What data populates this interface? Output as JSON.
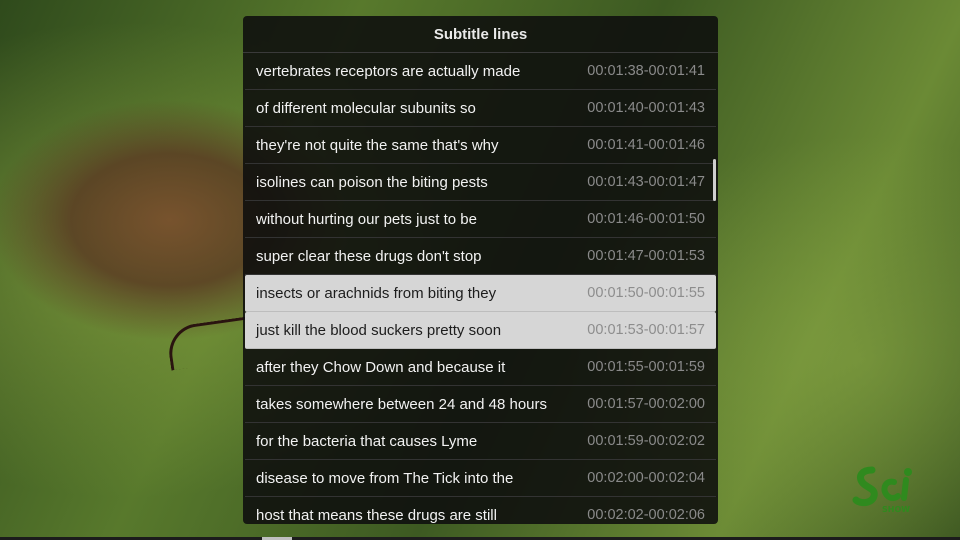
{
  "panel": {
    "title": "Subtitle lines"
  },
  "subtitles": [
    {
      "text": "vertebrates receptors are actually made",
      "time": "00:01:38-00:01:41"
    },
    {
      "text": "of different molecular subunits so",
      "time": "00:01:40-00:01:43"
    },
    {
      "text": "they're not quite the same that's why",
      "time": "00:01:41-00:01:46"
    },
    {
      "text": "isolines can poison the biting pests",
      "time": "00:01:43-00:01:47"
    },
    {
      "text": "without hurting our pets just to be",
      "time": "00:01:46-00:01:50"
    },
    {
      "text": "super clear these drugs don't stop",
      "time": "00:01:47-00:01:53"
    },
    {
      "text": "insects or arachnids from biting they",
      "time": "00:01:50-00:01:55",
      "selected": true
    },
    {
      "text": "just kill the blood suckers pretty soon",
      "time": "00:01:53-00:01:57",
      "selected": true
    },
    {
      "text": "after they Chow Down and because it",
      "time": "00:01:55-00:01:59"
    },
    {
      "text": "takes somewhere between 24 and 48 hours",
      "time": "00:01:57-00:02:00"
    },
    {
      "text": "for the bacteria that causes Lyme",
      "time": "00:01:59-00:02:02"
    },
    {
      "text": "disease to move from The Tick into the",
      "time": "00:02:00-00:02:04"
    },
    {
      "text": "host that means these drugs are still",
      "time": "00:02:02-00:02:06"
    }
  ],
  "logo": {
    "text": "SciShow",
    "color": "#2f8a1e"
  },
  "icons": {
    "logo": "scishow-logo-icon"
  }
}
